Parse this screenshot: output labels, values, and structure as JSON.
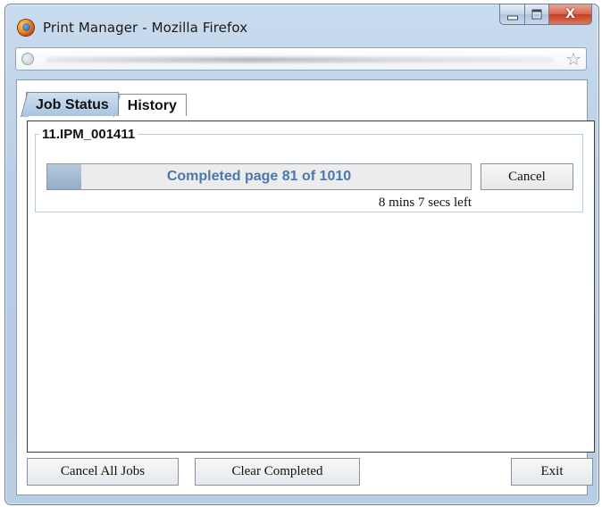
{
  "window": {
    "title": "Print Manager - Mozilla Firefox",
    "controls": {
      "minimize": "minimize",
      "maximize": "maximize",
      "close": "X"
    }
  },
  "urlbar": {
    "icons": [
      "globe-icon",
      "bookmark-star-icon"
    ]
  },
  "tabs": [
    {
      "label": "Job Status",
      "active": true
    },
    {
      "label": "History",
      "active": false
    }
  ],
  "job": {
    "name": "11.IPM_001411",
    "progress_text": "Completed page 81 of 1010",
    "progress_fraction": 0.0802,
    "cancel_label": "Cancel",
    "time_left": "8 mins 7 secs left"
  },
  "footer": {
    "cancel_all_label": "Cancel All Jobs",
    "clear_completed_label": "Clear Completed",
    "exit_label": "Exit"
  },
  "colors": {
    "progress_text": "#4a78b0",
    "progress_fill": "#94acc6",
    "active_tab": "#a9c4df"
  }
}
